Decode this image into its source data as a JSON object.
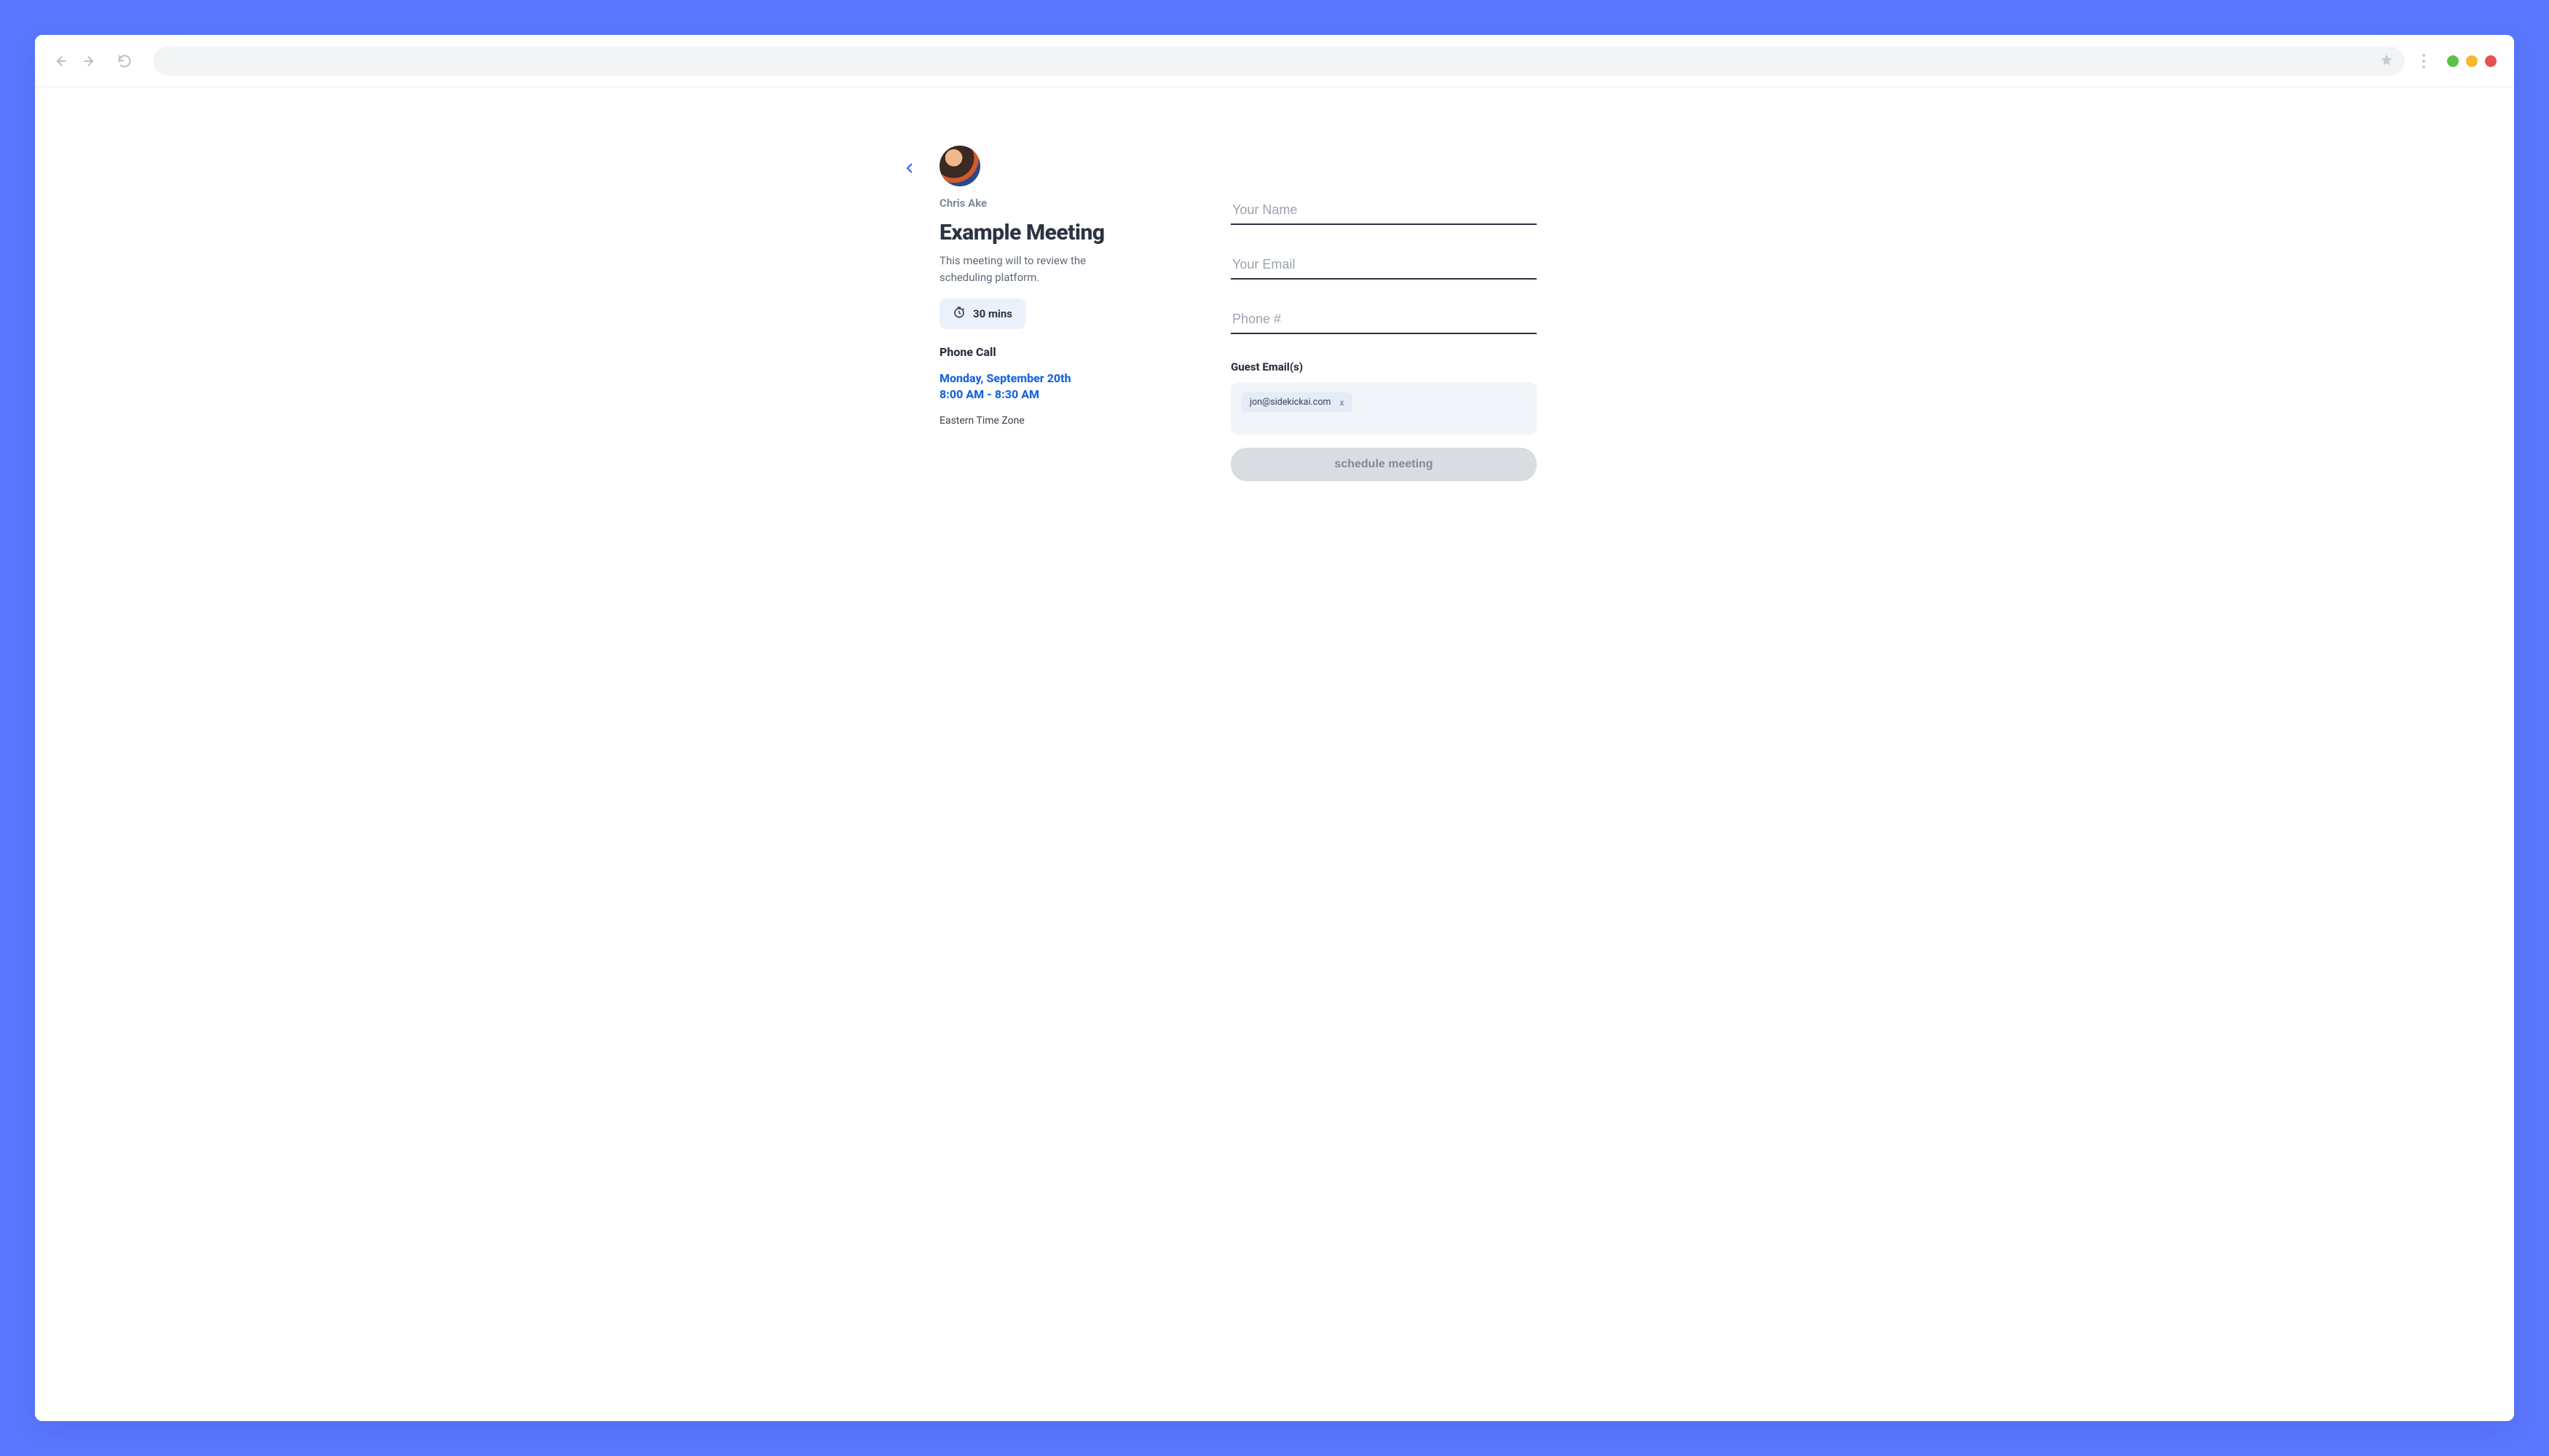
{
  "browser": {
    "address_value": "",
    "icons": {
      "back": "back-icon",
      "forward": "forward-icon",
      "reload": "reload-icon",
      "bookmark": "star-icon",
      "menu": "kebab-menu-icon"
    }
  },
  "meeting": {
    "host_name": "Chris Ake",
    "title": "Example Meeting",
    "description": "This meeting will to review the scheduling platform.",
    "duration_label": "30 mins",
    "type_label": "Phone Call",
    "date_line": "Monday, September 20th",
    "time_line": "8:00 AM - 8:30 AM",
    "timezone": "Eastern Time Zone"
  },
  "form": {
    "name_placeholder": "Your Name",
    "name_value": "",
    "email_placeholder": "Your Email",
    "email_value": "",
    "phone_placeholder": "Phone #",
    "phone_value": "",
    "guests_label": "Guest Email(s)",
    "guests": [
      {
        "email": "jon@sidekickai.com",
        "remove_label": "x"
      }
    ],
    "submit_label": "schedule meeting"
  },
  "colors": {
    "background": "#5a77ff",
    "accent": "#1766e0",
    "chip_bg": "#eaf1fb",
    "button_disabled_bg": "#d9dde2"
  }
}
